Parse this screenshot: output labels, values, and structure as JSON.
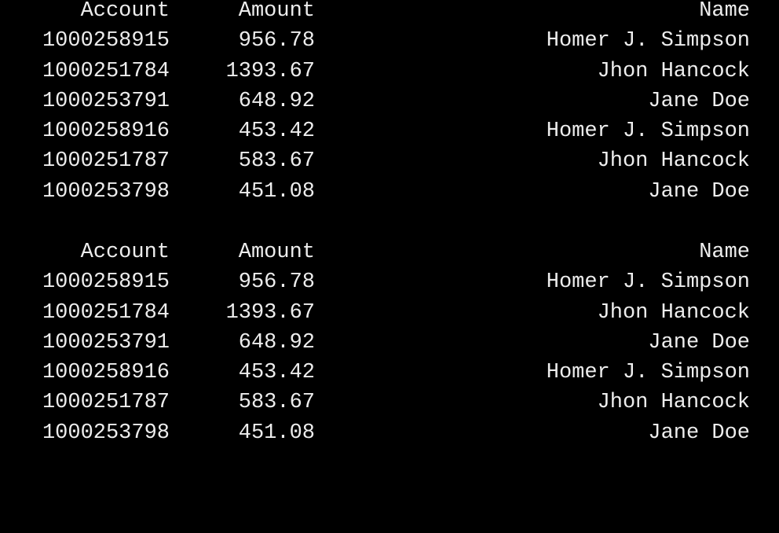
{
  "colors": {
    "background": "#000000",
    "text": "#ededed"
  },
  "tables": [
    {
      "headers": {
        "account": "Account",
        "amount": "Amount",
        "name": "Name"
      },
      "rows": [
        {
          "account": "1000258915",
          "amount": "956.78",
          "name": "Homer J. Simpson"
        },
        {
          "account": "1000251784",
          "amount": "1393.67",
          "name": "Jhon Hancock"
        },
        {
          "account": "1000253791",
          "amount": "648.92",
          "name": "Jane Doe"
        },
        {
          "account": "1000258916",
          "amount": "453.42",
          "name": "Homer J. Simpson"
        },
        {
          "account": "1000251787",
          "amount": "583.67",
          "name": "Jhon Hancock"
        },
        {
          "account": "1000253798",
          "amount": "451.08",
          "name": "Jane Doe"
        }
      ]
    },
    {
      "headers": {
        "account": "Account",
        "amount": "Amount",
        "name": "Name"
      },
      "rows": [
        {
          "account": "1000258915",
          "amount": "956.78",
          "name": "Homer J. Simpson"
        },
        {
          "account": "1000251784",
          "amount": "1393.67",
          "name": "Jhon Hancock"
        },
        {
          "account": "1000253791",
          "amount": "648.92",
          "name": "Jane Doe"
        },
        {
          "account": "1000258916",
          "amount": "453.42",
          "name": "Homer J. Simpson"
        },
        {
          "account": "1000251787",
          "amount": "583.67",
          "name": "Jhon Hancock"
        },
        {
          "account": "1000253798",
          "amount": "451.08",
          "name": "Jane Doe"
        }
      ]
    }
  ]
}
